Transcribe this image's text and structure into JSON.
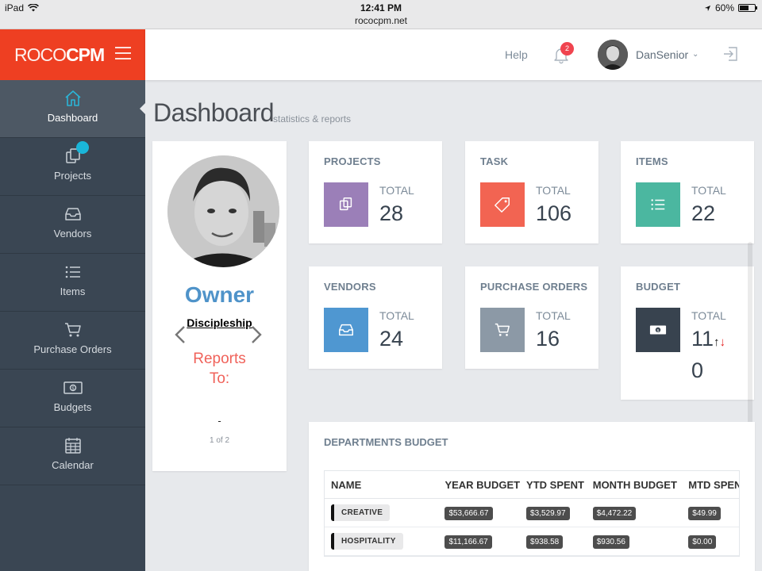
{
  "status_bar": {
    "device": "iPad",
    "time": "12:41 PM",
    "url": "rococpm.net",
    "battery": "60%",
    "battery_level": 0.6
  },
  "brand": {
    "logo_thin": "ROCO",
    "logo_bold": "CPM",
    "accent": "#ee3f22",
    "sidebar_bg": "#3a4653"
  },
  "sidebar": {
    "items": [
      {
        "label": "Dashboard",
        "icon": "home-icon",
        "active": true
      },
      {
        "label": "Projects",
        "icon": "documents-icon"
      },
      {
        "label": "Vendors",
        "icon": "inbox-icon"
      },
      {
        "label": "Items",
        "icon": "list-icon"
      },
      {
        "label": "Purchase Orders",
        "icon": "cart-icon"
      },
      {
        "label": "Budgets",
        "icon": "money-icon"
      },
      {
        "label": "Calendar",
        "icon": "calendar-icon"
      }
    ]
  },
  "topbar": {
    "help": "Help",
    "notifications": "2",
    "username": "DanSenior"
  },
  "page": {
    "title": "Dashboard",
    "subtitle": "statistics & reports"
  },
  "profile": {
    "role": "Owner",
    "department": "Discipleship",
    "reports_to": "Reports To:",
    "reports_value": "-",
    "pager": "1 of 2"
  },
  "stats": {
    "projects": {
      "title": "PROJECTS",
      "label": "TOTAL",
      "value": "28",
      "color": "#9b7fb8"
    },
    "task": {
      "title": "TASK",
      "label": "TOTAL",
      "value": "106",
      "color": "#f26452"
    },
    "items": {
      "title": "ITEMS",
      "label": "TOTAL",
      "value": "22",
      "color": "#4bb7a0"
    },
    "vendors": {
      "title": "VENDORS",
      "label": "TOTAL",
      "value": "24",
      "color": "#4f97d1"
    },
    "purchase_orders": {
      "title": "PURCHASE ORDERS",
      "label": "TOTAL",
      "value": "16",
      "color": "#8c99a6"
    },
    "budget": {
      "title": "BUDGET",
      "label": "TOTAL",
      "value": "11",
      "value2": "0",
      "color": "#38434f"
    }
  },
  "departments": {
    "title": "DEPARTMENTS BUDGET",
    "columns": [
      "NAME",
      "YEAR BUDGET",
      "YTD SPENT",
      "MONTH BUDGET",
      "MTD SPENT"
    ],
    "rows": [
      {
        "name": "CREATIVE",
        "year": "$53,666.67",
        "ytd": "$3,529.97",
        "month": "$4,472.22",
        "mtd": "$49.99"
      },
      {
        "name": "HOSPITALITY",
        "year": "$11,166.67",
        "ytd": "$938.58",
        "month": "$930.56",
        "mtd": "$0.00"
      }
    ]
  }
}
